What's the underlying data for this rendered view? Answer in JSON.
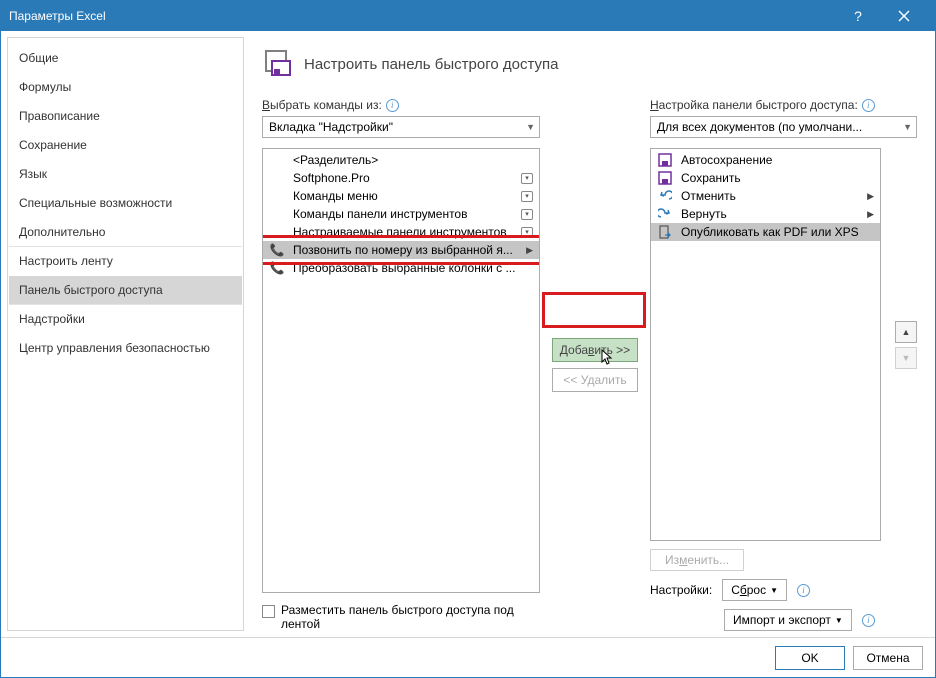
{
  "window": {
    "title": "Параметры Excel"
  },
  "sidebar": {
    "items": [
      {
        "label": "Общие"
      },
      {
        "label": "Формулы"
      },
      {
        "label": "Правописание"
      },
      {
        "label": "Сохранение"
      },
      {
        "label": "Язык"
      },
      {
        "label": "Специальные возможности"
      },
      {
        "label": "Дополнительно"
      },
      {
        "label": "Настроить ленту"
      },
      {
        "label": "Панель быстрого доступа"
      },
      {
        "label": "Надстройки"
      },
      {
        "label": "Центр управления безопасностью"
      }
    ]
  },
  "header": {
    "title": "Настроить панель быстрого доступа"
  },
  "left": {
    "label_prefix": "В",
    "label_rest": "ыбрать команды из:",
    "combo": "Вкладка \"Надстройки\"",
    "items": [
      {
        "text": "<Разделитель>",
        "icon": ""
      },
      {
        "text": "Softphone.Pro",
        "icon": "",
        "dd": true
      },
      {
        "text": "Команды меню",
        "icon": "",
        "dd": true
      },
      {
        "text": "Команды панели инструментов",
        "icon": "",
        "dd": true
      },
      {
        "text": "Настраиваемые панели инструментов",
        "icon": "",
        "dd": true
      },
      {
        "text": "Позвонить по номеру из выбранной я...",
        "icon": "phone",
        "arrow": true
      },
      {
        "text": "Преобразовать выбранные колонки с ...",
        "icon": "phone"
      }
    ]
  },
  "right": {
    "label_prefix": "Н",
    "label_rest": "астройка панели быстрого доступа:",
    "combo": "Для всех документов (по умолчани...",
    "items": [
      {
        "text": "Автосохранение",
        "icon": "save-toggle"
      },
      {
        "text": "Сохранить",
        "icon": "save"
      },
      {
        "text": "Отменить",
        "icon": "undo",
        "arrow": true
      },
      {
        "text": "Вернуть",
        "icon": "redo",
        "arrow": true
      },
      {
        "text": "Опубликовать как PDF или XPS",
        "icon": "publish"
      }
    ],
    "modify": "Изменить...",
    "settings_label": "Настройки:",
    "reset_btn": "Сброс",
    "import_btn": "Импорт и экспорт"
  },
  "mid": {
    "add": "Добавить >>",
    "remove": "<< Удалить"
  },
  "checkbox": {
    "label": "Разместить панель быстрого доступа под лентой"
  },
  "footer": {
    "ok": "OK",
    "cancel": "Отмена"
  }
}
